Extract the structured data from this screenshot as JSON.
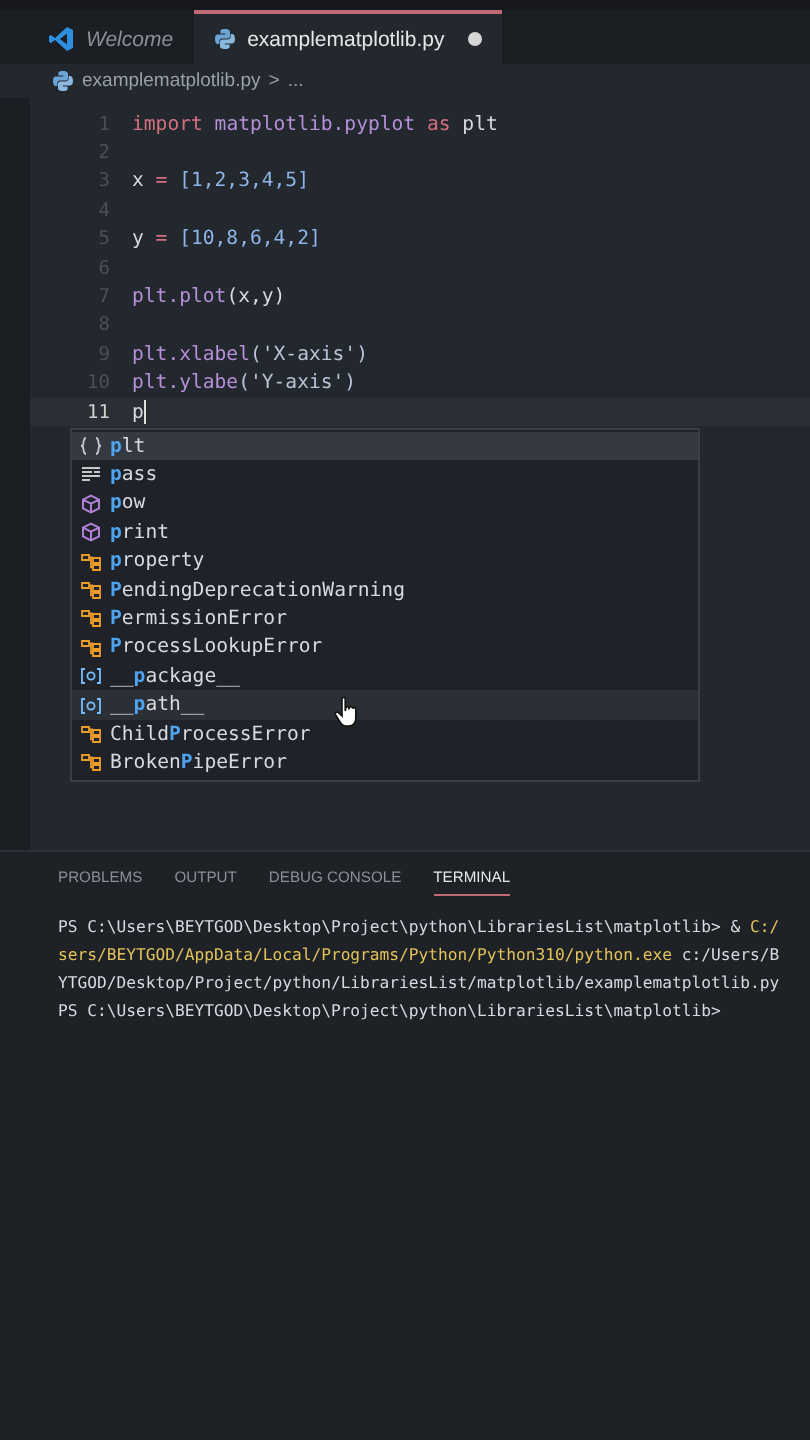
{
  "tabs": [
    {
      "kind": "welcome",
      "label": "Welcome",
      "selected": false,
      "modified": false
    },
    {
      "kind": "python",
      "label": "examplematplotlib.py",
      "selected": true,
      "modified": true
    }
  ],
  "breadcrumb": {
    "file": "examplematplotlib.py",
    "separator": ">",
    "rest": "..."
  },
  "editor": {
    "lines": [
      {
        "number": "1",
        "current": false,
        "tokens": [
          {
            "kind": "keyword",
            "text": "import "
          },
          {
            "kind": "module",
            "text": "matplotlib.pyplot "
          },
          {
            "kind": "keyword",
            "text": "as "
          },
          {
            "kind": "name",
            "text": "plt"
          }
        ]
      },
      {
        "number": "2",
        "current": false
      },
      {
        "number": "3",
        "current": false,
        "tokens": [
          {
            "kind": "name",
            "text": "x "
          },
          {
            "kind": "op",
            "text": "= "
          },
          {
            "kind": "number",
            "text": "[1,2,3,4,5]"
          }
        ]
      },
      {
        "number": "4",
        "current": false
      },
      {
        "number": "5",
        "current": false,
        "tokens": [
          {
            "kind": "name",
            "text": "y "
          },
          {
            "kind": "op",
            "text": "= "
          },
          {
            "kind": "number",
            "text": "[10,8,6,4,2]"
          }
        ]
      },
      {
        "number": "6",
        "current": false
      },
      {
        "number": "7",
        "current": false,
        "tokens": [
          {
            "kind": "module",
            "text": "plt.plot"
          },
          {
            "kind": "name",
            "text": "(x,y)"
          }
        ]
      },
      {
        "number": "8",
        "current": false
      },
      {
        "number": "9",
        "current": false,
        "tokens": [
          {
            "kind": "module",
            "text": "plt.xlabel"
          },
          {
            "kind": "string",
            "text": "('X-axis')"
          }
        ]
      },
      {
        "number": "10",
        "current": false,
        "tokens": [
          {
            "kind": "module",
            "text": "plt.ylabe"
          },
          {
            "kind": "string",
            "text": "('Y-axis')"
          }
        ]
      },
      {
        "number": "11",
        "current": true,
        "tokens": [
          {
            "kind": "name",
            "text": "p"
          }
        ]
      }
    ]
  },
  "suggestions": [
    {
      "kind": "module",
      "match": "p",
      "after": "lt",
      "selected": true,
      "hovered": false
    },
    {
      "kind": "keyword",
      "match": "p",
      "after": "ass",
      "selected": false,
      "hovered": false
    },
    {
      "kind": "function",
      "match": "p",
      "after": "ow",
      "selected": false,
      "hovered": false
    },
    {
      "kind": "function",
      "match": "p",
      "after": "rint",
      "selected": false,
      "hovered": false
    },
    {
      "kind": "class",
      "match": "p",
      "after": "roperty",
      "selected": false,
      "hovered": false
    },
    {
      "kind": "class",
      "match": "P",
      "after": "endingDeprecationWarning",
      "selected": false,
      "hovered": false
    },
    {
      "kind": "class",
      "match": "P",
      "after": "ermissionError",
      "selected": false,
      "hovered": false
    },
    {
      "kind": "class",
      "match": "P",
      "after": "rocessLookupError",
      "selected": false,
      "hovered": false
    },
    {
      "kind": "variable",
      "before": "__",
      "match": "p",
      "after": "ackage__",
      "selected": false,
      "hovered": false
    },
    {
      "kind": "variable",
      "before": "__",
      "match": "p",
      "after": "ath__",
      "selected": false,
      "hovered": true
    },
    {
      "kind": "class",
      "before": "Child",
      "match": "P",
      "after": "rocessError",
      "selected": false,
      "hovered": false
    },
    {
      "kind": "class",
      "before": "Broken",
      "match": "P",
      "after": "ipeError",
      "selected": false,
      "hovered": false
    }
  ],
  "panel": {
    "tabs": [
      {
        "label": "PROBLEMS",
        "selected": false
      },
      {
        "label": "OUTPUT",
        "selected": false
      },
      {
        "label": "DEBUG CONSOLE",
        "selected": false
      },
      {
        "label": "TERMINAL",
        "selected": true
      }
    ],
    "terminal": [
      [
        {
          "kind": "plain",
          "text": "PS C:\\Users\\BEYTGOD\\Desktop\\Project\\python\\LibrariesList\\matplotlib> & "
        },
        {
          "kind": "path",
          "text": "C:/"
        }
      ],
      [
        {
          "kind": "path",
          "text": "sers/BEYTGOD/AppData/Local/Programs/Python/Python310/python.exe"
        },
        {
          "kind": "plain",
          "text": " c:/Users/B"
        }
      ],
      [
        {
          "kind": "plain",
          "text": "YTGOD/Desktop/Project/python/LibrariesList/matplotlib/examplematplotlib.py"
        }
      ],
      [
        {
          "kind": "plain",
          "text": "PS C:\\Users\\BEYTGOD\\Desktop\\Project\\python\\LibrariesList\\matplotlib>"
        }
      ]
    ]
  }
}
